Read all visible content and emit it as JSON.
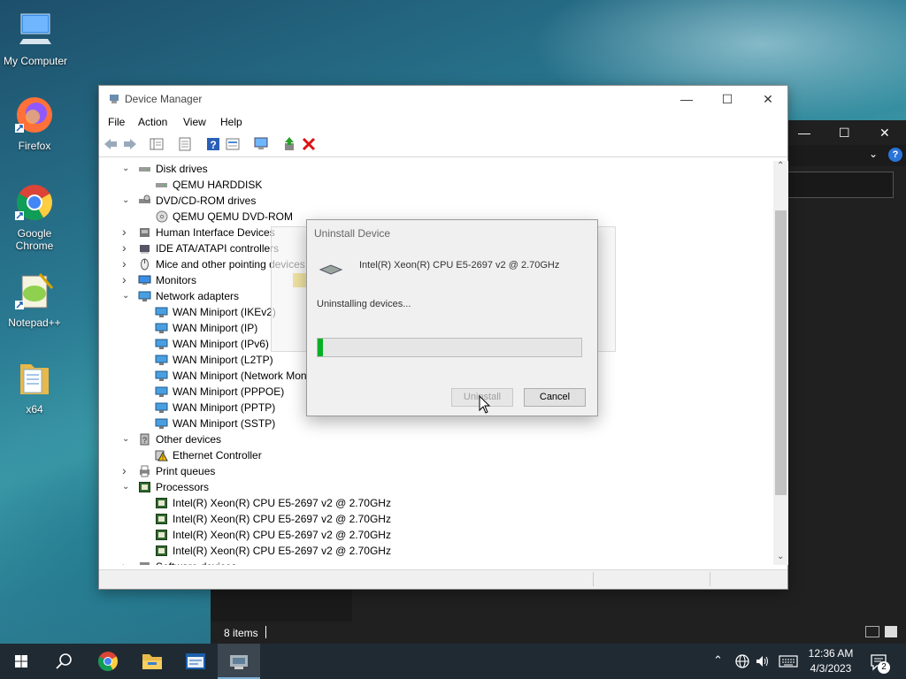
{
  "desktop": {
    "icons": [
      {
        "label": "My Computer"
      },
      {
        "label": "Firefox"
      },
      {
        "label": "Google Chrome"
      },
      {
        "label": "Notepad++"
      },
      {
        "label": "x64"
      }
    ]
  },
  "bg_window": {
    "status_text": "8 items",
    "minimize": "—",
    "maximize": "☐",
    "close": "✕"
  },
  "device_manager": {
    "title": "Device Manager",
    "menu": [
      "File",
      "Action",
      "View",
      "Help"
    ],
    "tree": [
      {
        "label": "Disk drives",
        "level": 0,
        "expanded": true,
        "icon": "disk-drive-icon"
      },
      {
        "label": "QEMU HARDDISK",
        "level": 1,
        "icon": "disk-drive-icon"
      },
      {
        "label": "DVD/CD-ROM drives",
        "level": 0,
        "expanded": true,
        "icon": "dvd-drive-icon"
      },
      {
        "label": "QEMU QEMU DVD-ROM",
        "level": 1,
        "icon": "dvd-disc-icon"
      },
      {
        "label": "Human Interface Devices",
        "level": 0,
        "expanded": false,
        "icon": "hid-icon"
      },
      {
        "label": "IDE ATA/ATAPI controllers",
        "level": 0,
        "expanded": false,
        "icon": "ide-controller-icon"
      },
      {
        "label": "Mice and other pointing devices",
        "level": 0,
        "expanded": false,
        "icon": "mouse-icon"
      },
      {
        "label": "Monitors",
        "level": 0,
        "expanded": false,
        "icon": "monitor-icon"
      },
      {
        "label": "Network adapters",
        "level": 0,
        "expanded": true,
        "icon": "network-adapter-icon"
      },
      {
        "label": "WAN Miniport (IKEv2)",
        "level": 1,
        "icon": "network-adapter-icon"
      },
      {
        "label": "WAN Miniport (IP)",
        "level": 1,
        "icon": "network-adapter-icon"
      },
      {
        "label": "WAN Miniport (IPv6)",
        "level": 1,
        "icon": "network-adapter-icon"
      },
      {
        "label": "WAN Miniport (L2TP)",
        "level": 1,
        "icon": "network-adapter-icon"
      },
      {
        "label": "WAN Miniport (Network Monitor)",
        "level": 1,
        "icon": "network-adapter-icon"
      },
      {
        "label": "WAN Miniport (PPPOE)",
        "level": 1,
        "icon": "network-adapter-icon"
      },
      {
        "label": "WAN Miniport (PPTP)",
        "level": 1,
        "icon": "network-adapter-icon"
      },
      {
        "label": "WAN Miniport (SSTP)",
        "level": 1,
        "icon": "network-adapter-icon"
      },
      {
        "label": "Other devices",
        "level": 0,
        "expanded": true,
        "icon": "unknown-device-icon"
      },
      {
        "label": "Ethernet Controller",
        "level": 1,
        "icon": "warning-device-icon"
      },
      {
        "label": "Print queues",
        "level": 0,
        "expanded": false,
        "icon": "printer-icon"
      },
      {
        "label": "Processors",
        "level": 0,
        "expanded": true,
        "icon": "processor-icon"
      },
      {
        "label": "Intel(R) Xeon(R) CPU E5-2697 v2 @ 2.70GHz",
        "level": 1,
        "icon": "processor-icon"
      },
      {
        "label": "Intel(R) Xeon(R) CPU E5-2697 v2 @ 2.70GHz",
        "level": 1,
        "icon": "processor-icon"
      },
      {
        "label": "Intel(R) Xeon(R) CPU E5-2697 v2 @ 2.70GHz",
        "level": 1,
        "icon": "processor-icon"
      },
      {
        "label": "Intel(R) Xeon(R) CPU E5-2697 v2 @ 2.70GHz",
        "level": 1,
        "icon": "processor-icon"
      },
      {
        "label": "Software devices",
        "level": 0,
        "expanded": false,
        "icon": "software-device-icon"
      }
    ]
  },
  "uninstall_dialog": {
    "title": "Uninstall Device",
    "device_name": "Intel(R) Xeon(R) CPU E5-2697 v2 @ 2.70GHz",
    "status": "Uninstalling devices...",
    "progress": 0.02,
    "uninstall_label": "Uninstall",
    "cancel_label": "Cancel"
  },
  "taskbar": {
    "time": "12:36 AM",
    "date": "4/3/2023",
    "notification_count": "2"
  },
  "colors": {
    "progress_fill": "#06b025",
    "taskbar": "#1f2a33",
    "bg_window": "#202020"
  }
}
